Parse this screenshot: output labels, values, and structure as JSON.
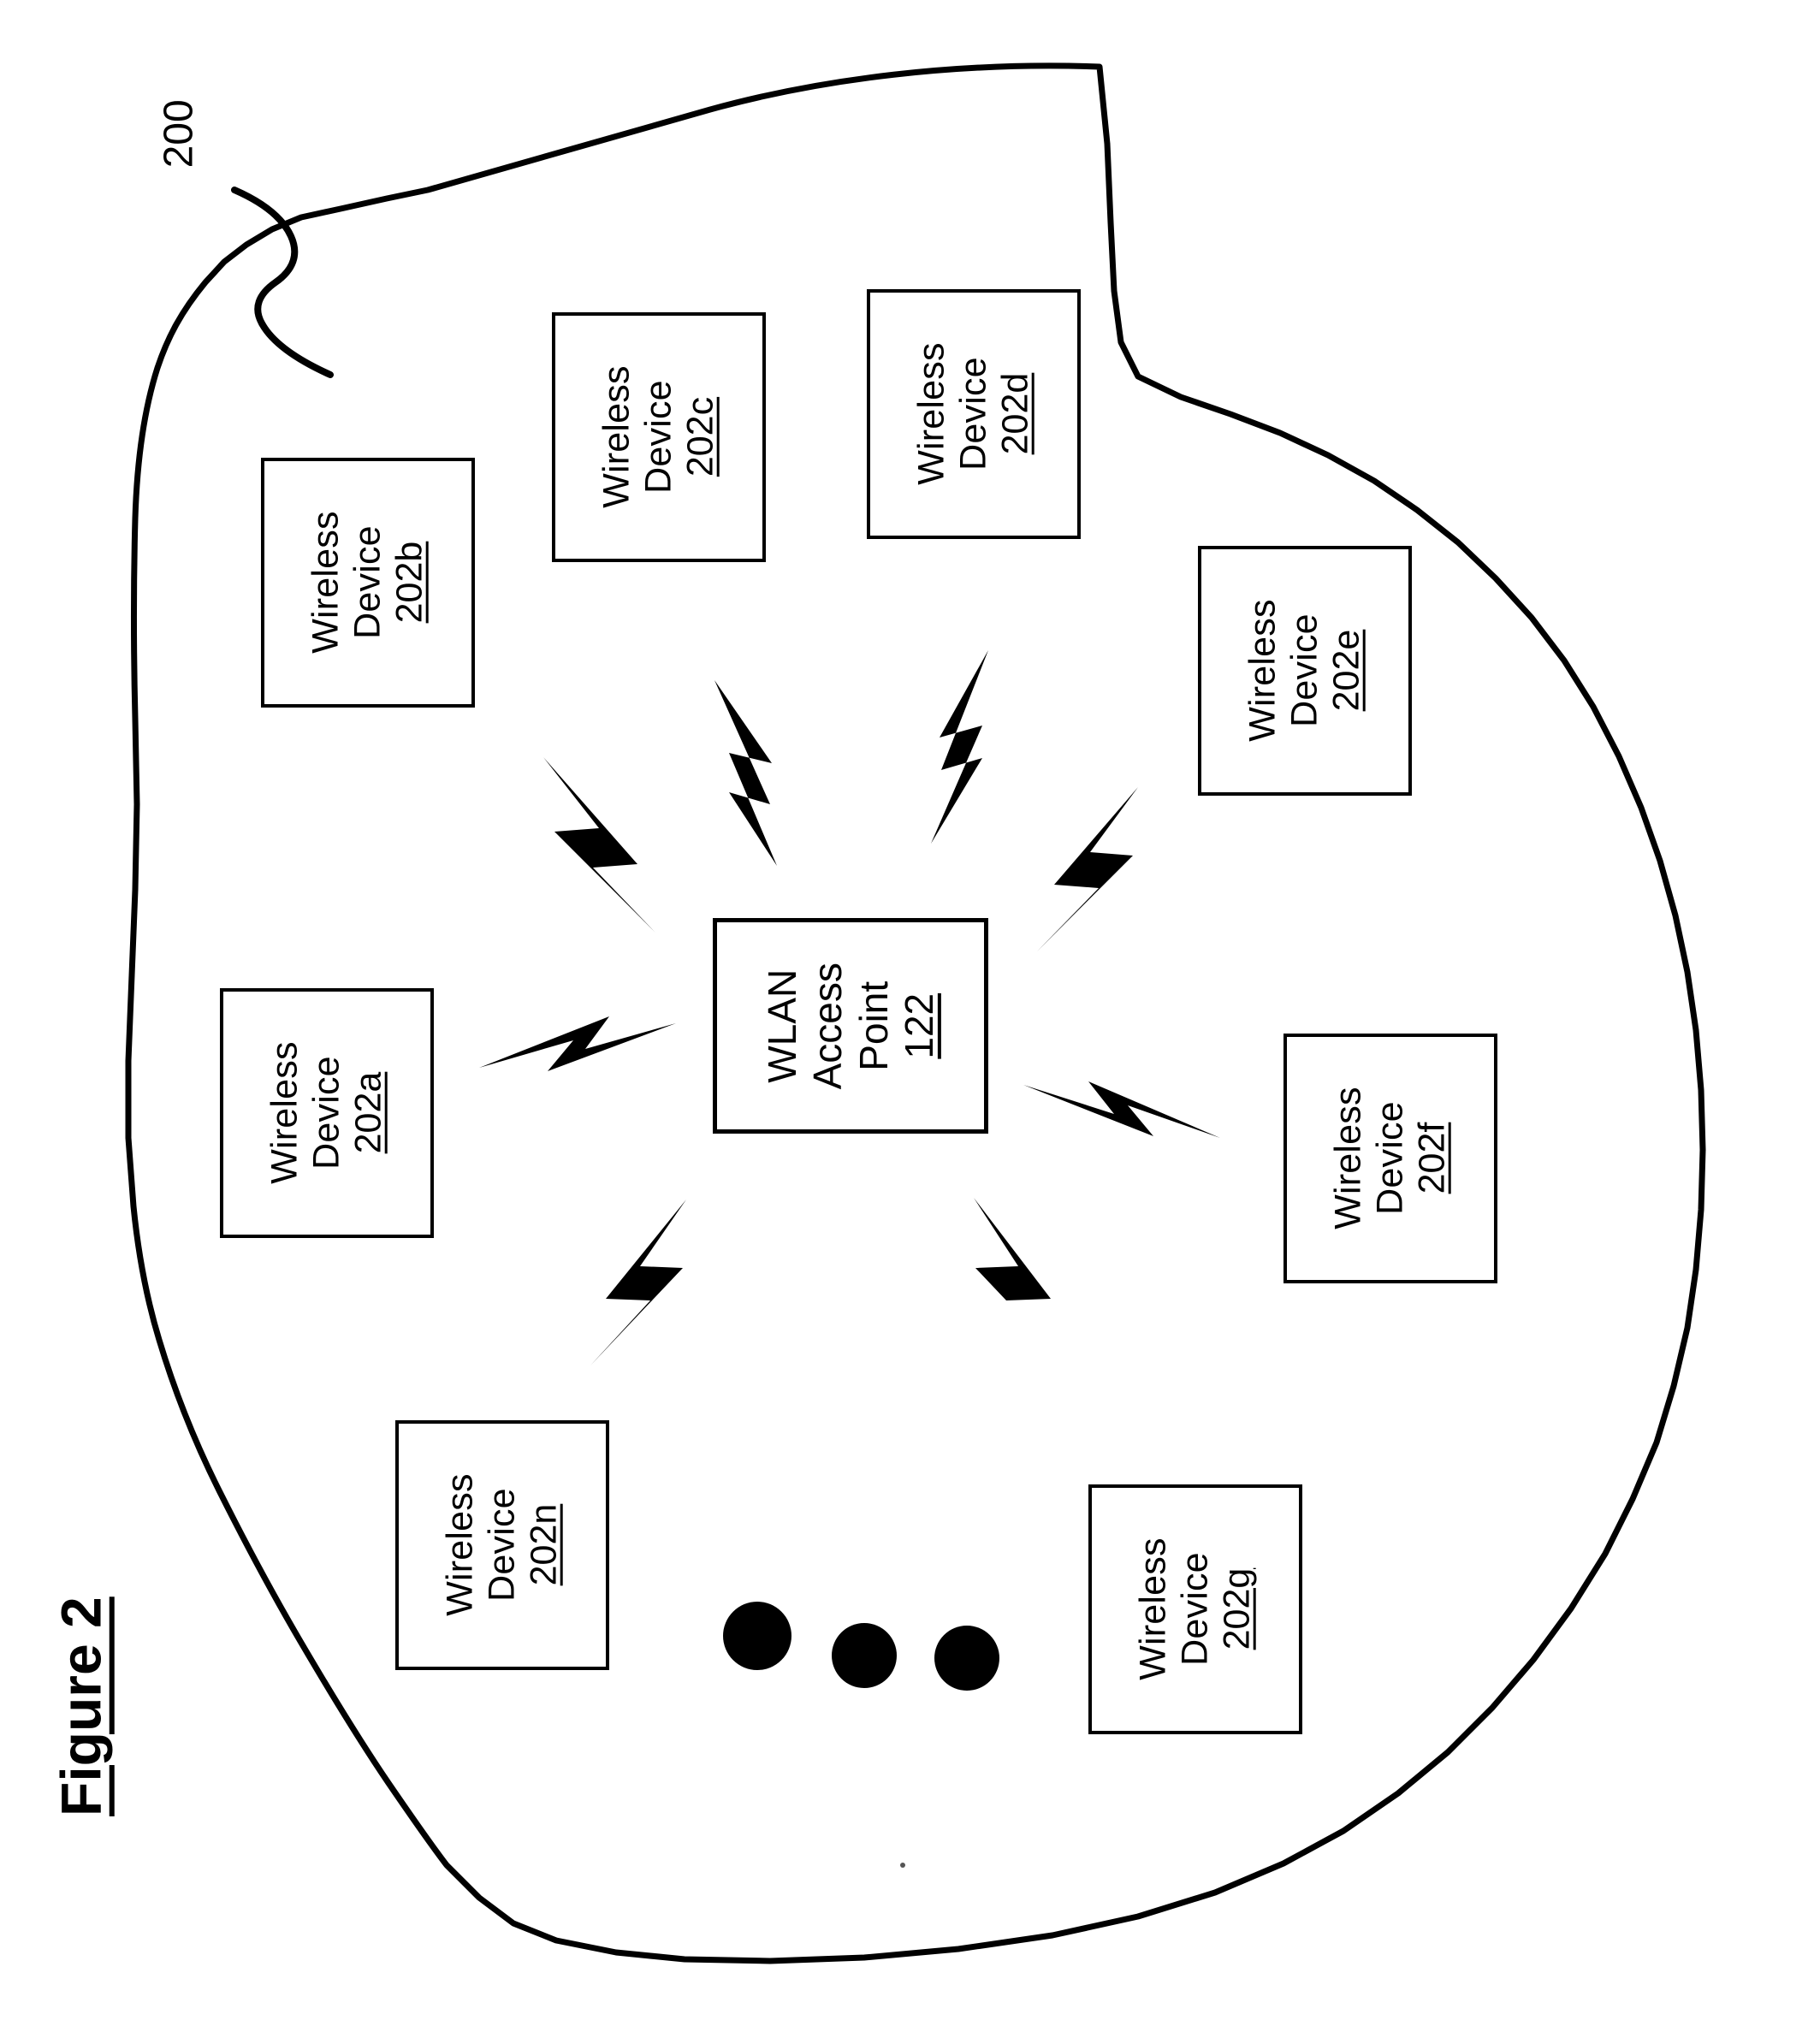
{
  "figure": {
    "caption": "Figure 2",
    "reference_numeral": "200",
    "line_color": "#000000",
    "background_color": "#ffffff"
  },
  "access_point": {
    "line1": "WLAN",
    "line2": "Access",
    "line3": "Point",
    "number": "122"
  },
  "devices": [
    {
      "line1": "Wireless",
      "line2": "Device",
      "number": "202a"
    },
    {
      "line1": "Wireless",
      "line2": "Device",
      "number": "202b"
    },
    {
      "line1": "Wireless",
      "line2": "Device",
      "number": "202c"
    },
    {
      "line1": "Wireless",
      "line2": "Device",
      "number": "202d"
    },
    {
      "line1": "Wireless",
      "line2": "Device",
      "number": "202e"
    },
    {
      "line1": "Wireless",
      "line2": "Device",
      "number": "202f"
    },
    {
      "line1": "Wireless",
      "line2": "Device",
      "number": "202g"
    },
    {
      "line1": "Wireless",
      "line2": "Device",
      "number": "202n"
    }
  ],
  "ellipsis": {
    "dot_count": 3
  },
  "signal_bolts": {
    "count": 8
  }
}
